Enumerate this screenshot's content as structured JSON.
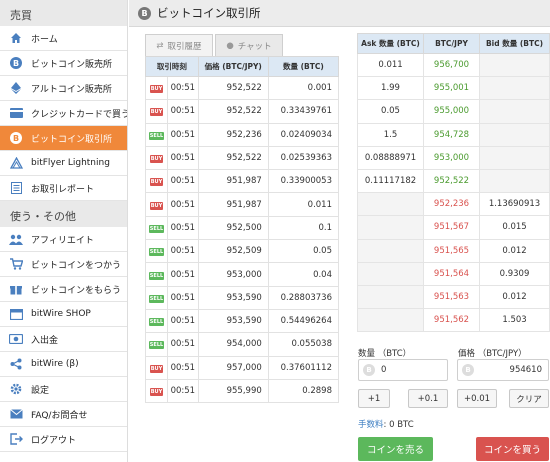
{
  "sidebar": {
    "section1": "売買",
    "section2": "使う・その他",
    "items1": [
      {
        "label": "ホーム",
        "icon": "home-icon"
      },
      {
        "label": "ビットコイン販売所",
        "icon": "bitcoin-icon"
      },
      {
        "label": "アルトコイン販売所",
        "icon": "ethereum-icon"
      },
      {
        "label": "クレジットカードで買う",
        "icon": "credit-card-icon"
      },
      {
        "label": "ビットコイン取引所",
        "icon": "bitcoin-icon",
        "active": true
      },
      {
        "label": "bitFlyer Lightning",
        "icon": "lightning-icon"
      },
      {
        "label": "お取引レポート",
        "icon": "report-icon"
      }
    ],
    "items2": [
      {
        "label": "アフィリエイト",
        "icon": "users-icon"
      },
      {
        "label": "ビットコインをつかう",
        "icon": "cart-icon"
      },
      {
        "label": "ビットコインをもらう",
        "icon": "gift-icon"
      },
      {
        "label": "bitWire SHOP",
        "icon": "shop-icon"
      },
      {
        "label": "入出金",
        "icon": "money-icon"
      },
      {
        "label": "bitWire (β)",
        "icon": "share-icon"
      },
      {
        "label": "設定",
        "icon": "gear-icon"
      },
      {
        "label": "FAQ/お問合せ",
        "icon": "mail-icon"
      },
      {
        "label": "ログアウト",
        "icon": "logout-icon"
      }
    ]
  },
  "header": {
    "title": "ビットコイン取引所",
    "coin_glyph": "B"
  },
  "tabs": [
    {
      "label": "取引履歴",
      "icon": "exchange-icon"
    },
    {
      "label": "チャット",
      "icon": "chat-icon"
    }
  ],
  "trades": {
    "columns": [
      "取引時刻",
      "価格 (BTC/JPY)",
      "数量 (BTC)"
    ],
    "rows": [
      {
        "side": "BUY",
        "time": "00:51",
        "price": "952,522",
        "qty": "0.001"
      },
      {
        "side": "BUY",
        "time": "00:51",
        "price": "952,522",
        "qty": "0.33439761"
      },
      {
        "side": "SELL",
        "time": "00:51",
        "price": "952,236",
        "qty": "0.02409034"
      },
      {
        "side": "BUY",
        "time": "00:51",
        "price": "952,522",
        "qty": "0.02539363"
      },
      {
        "side": "BUY",
        "time": "00:51",
        "price": "951,987",
        "qty": "0.33900053"
      },
      {
        "side": "BUY",
        "time": "00:51",
        "price": "951,987",
        "qty": "0.011"
      },
      {
        "side": "SELL",
        "time": "00:51",
        "price": "952,500",
        "qty": "0.1"
      },
      {
        "side": "SELL",
        "time": "00:51",
        "price": "952,509",
        "qty": "0.05"
      },
      {
        "side": "SELL",
        "time": "00:51",
        "price": "953,000",
        "qty": "0.04"
      },
      {
        "side": "SELL",
        "time": "00:51",
        "price": "953,590",
        "qty": "0.28803736"
      },
      {
        "side": "SELL",
        "time": "00:51",
        "price": "953,590",
        "qty": "0.54496264"
      },
      {
        "side": "SELL",
        "time": "00:51",
        "price": "954,000",
        "qty": "0.055038"
      },
      {
        "side": "BUY",
        "time": "00:51",
        "price": "957,000",
        "qty": "0.37601112"
      },
      {
        "side": "BUY",
        "time": "00:51",
        "price": "955,990",
        "qty": "0.2898"
      }
    ]
  },
  "book": {
    "columns": [
      "Ask 数量 (BTC)",
      "BTC/JPY",
      "Bid 数量 (BTC)"
    ],
    "asks": [
      {
        "qty": "0.011",
        "price": "956,700"
      },
      {
        "qty": "1.99",
        "price": "955,001"
      },
      {
        "qty": "0.05",
        "price": "955,000"
      },
      {
        "qty": "1.5",
        "price": "954,728"
      },
      {
        "qty": "0.08888971",
        "price": "953,000"
      },
      {
        "qty": "0.11117182",
        "price": "952,522"
      }
    ],
    "bids": [
      {
        "price": "952,236",
        "qty": "1.13690913"
      },
      {
        "price": "951,567",
        "qty": "0.015"
      },
      {
        "price": "951,565",
        "qty": "0.012"
      },
      {
        "price": "951,564",
        "qty": "0.9309"
      },
      {
        "price": "951,563",
        "qty": "0.012"
      },
      {
        "price": "951,562",
        "qty": "1.503"
      }
    ]
  },
  "order": {
    "qty_label": "数量 （BTC）",
    "qty_value": "0",
    "price_label": "価格 （BTC/JPY）",
    "price_value": "954610",
    "btn_plus1": "+1",
    "btn_plus01": "+0.1",
    "btn_plus001": "+0.01",
    "btn_clear": "クリア",
    "fee_label": "手数料",
    "fee_value": ": 0 BTC",
    "sell_label": "コインを売る",
    "buy_label": "コインを買う"
  },
  "colors": {
    "accent": "#f0883a",
    "buy": "#d9534f",
    "sell": "#5cb85c",
    "price_ask": "#4b9b2f",
    "price_bid": "#d9534f"
  }
}
